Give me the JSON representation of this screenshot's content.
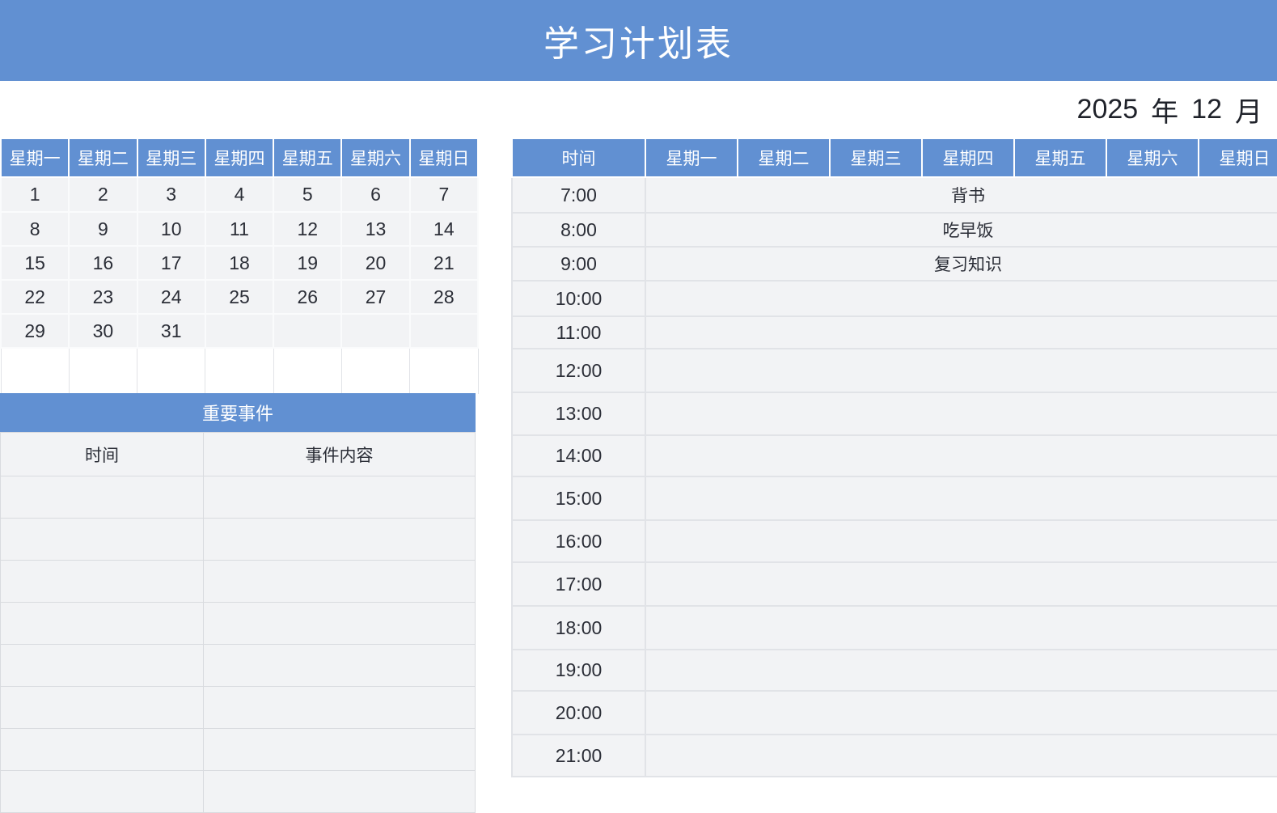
{
  "title": "学习计划表",
  "date": {
    "year": "2025",
    "year_label": "年",
    "month": "12",
    "month_label": "月"
  },
  "colors": {
    "accent": "#6190d2",
    "cell_bg": "#f2f3f5",
    "grid_line": "#e1e3e7",
    "text_dark": "#2b2e37"
  },
  "calendar": {
    "weekday_headers": [
      "星期一",
      "星期二",
      "星期三",
      "星期四",
      "星期五",
      "星期六",
      "星期日"
    ],
    "weeks": [
      [
        "1",
        "2",
        "3",
        "4",
        "5",
        "6",
        "7"
      ],
      [
        "8",
        "9",
        "10",
        "11",
        "12",
        "13",
        "14"
      ],
      [
        "15",
        "16",
        "17",
        "18",
        "19",
        "20",
        "21"
      ],
      [
        "22",
        "23",
        "24",
        "25",
        "26",
        "27",
        "28"
      ],
      [
        "29",
        "30",
        "31",
        "",
        "",
        "",
        ""
      ]
    ]
  },
  "important_events": {
    "title": "重要事件",
    "columns": [
      "时间",
      "事件内容"
    ],
    "rows": [
      [
        "",
        ""
      ],
      [
        "",
        ""
      ],
      [
        "",
        ""
      ],
      [
        "",
        ""
      ],
      [
        "",
        ""
      ],
      [
        "",
        ""
      ],
      [
        "",
        ""
      ],
      [
        "",
        ""
      ]
    ]
  },
  "schedule": {
    "headers": [
      "时间",
      "星期一",
      "星期二",
      "星期三",
      "星期四",
      "星期五",
      "星期六",
      "星期日"
    ],
    "rows": [
      {
        "time": "7:00",
        "activity": "背书"
      },
      {
        "time": "8:00",
        "activity": "吃早饭"
      },
      {
        "time": "9:00",
        "activity": "复习知识"
      },
      {
        "time": "10:00",
        "activity": ""
      },
      {
        "time": "11:00",
        "activity": ""
      },
      {
        "time": "12:00",
        "activity": ""
      },
      {
        "time": "13:00",
        "activity": ""
      },
      {
        "time": "14:00",
        "activity": ""
      },
      {
        "time": "15:00",
        "activity": ""
      },
      {
        "time": "16:00",
        "activity": ""
      },
      {
        "time": "17:00",
        "activity": ""
      },
      {
        "time": "18:00",
        "activity": ""
      },
      {
        "time": "19:00",
        "activity": ""
      },
      {
        "time": "20:00",
        "activity": ""
      },
      {
        "time": "21:00",
        "activity": ""
      }
    ]
  }
}
